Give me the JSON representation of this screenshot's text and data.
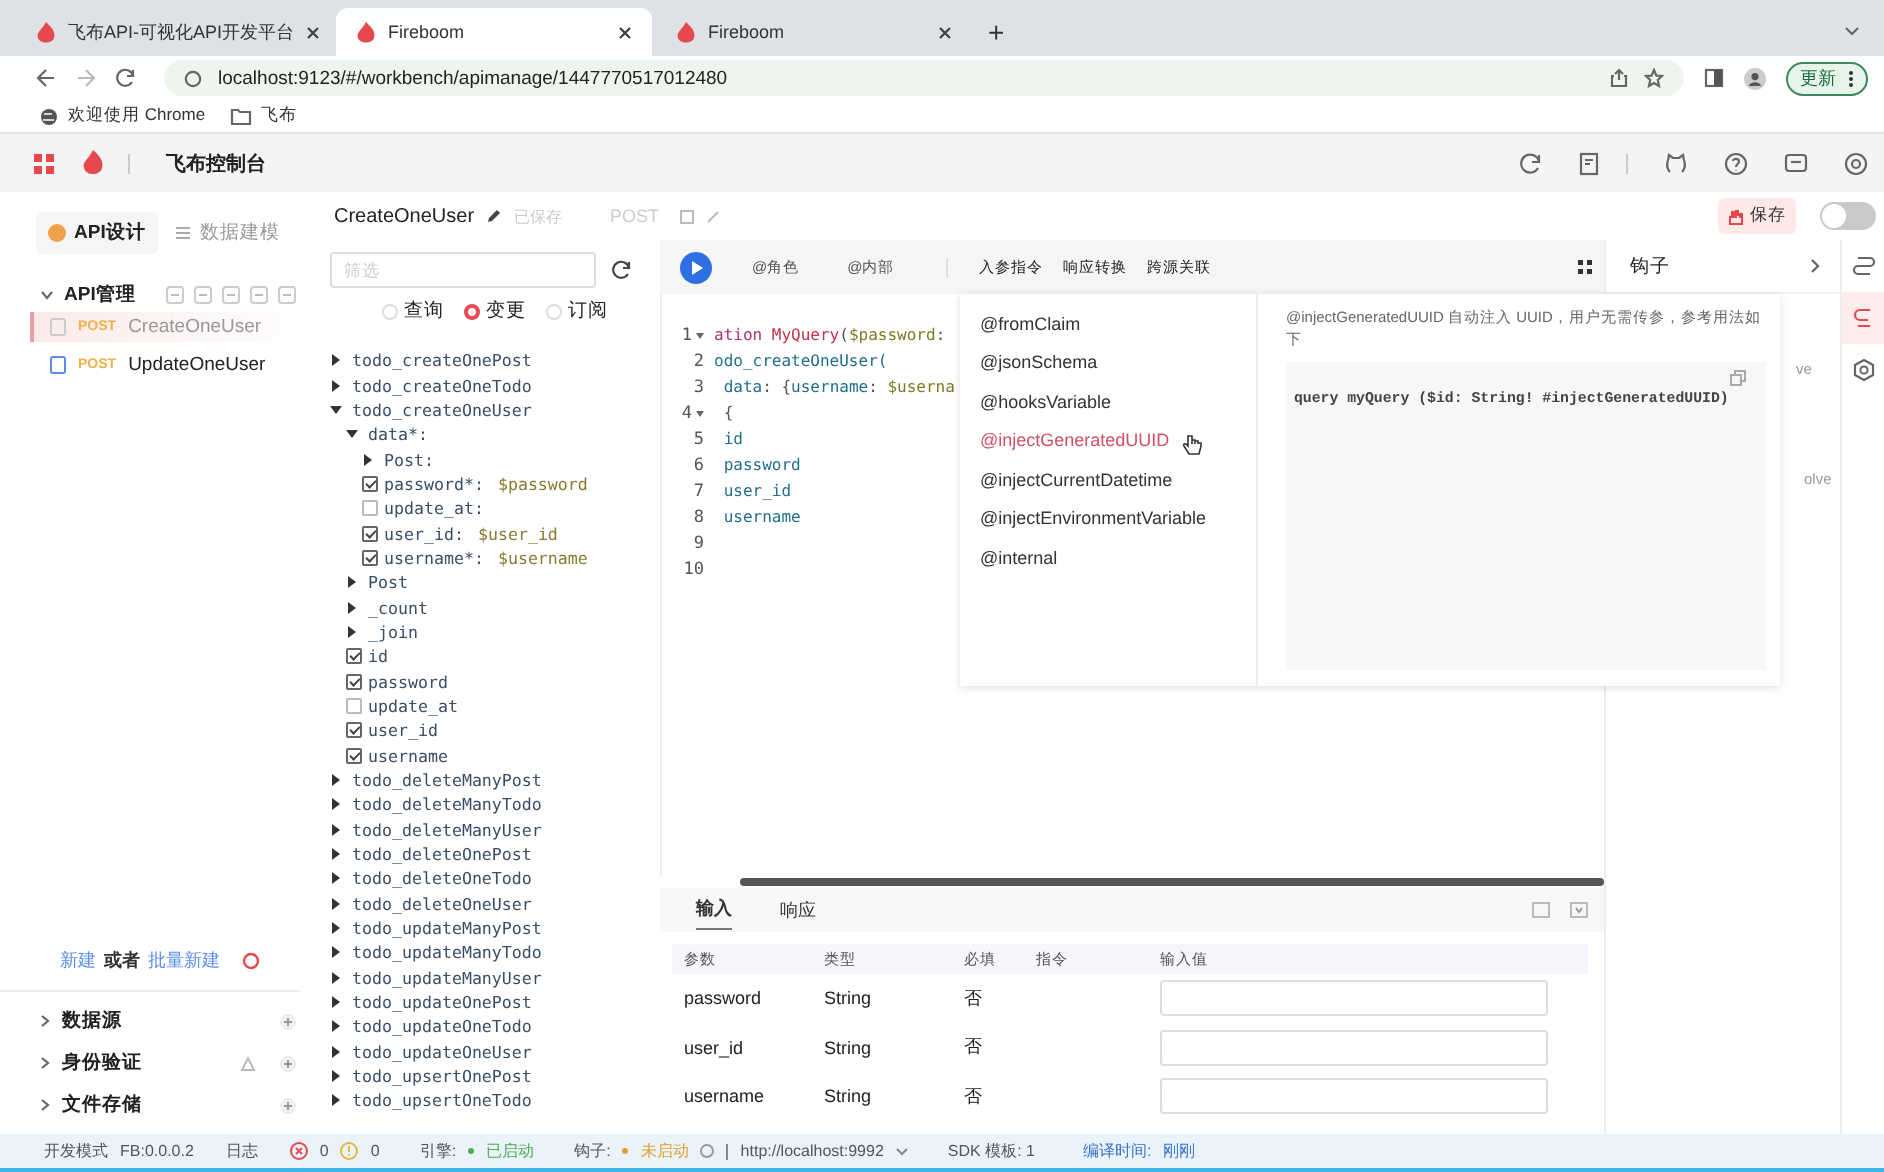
{
  "browser": {
    "tabs": [
      {
        "title": "飞布API-可视化API开发平台",
        "selected": false
      },
      {
        "title": "Fireboom",
        "selected": true
      },
      {
        "title": "Fireboom",
        "selected": false
      }
    ],
    "new_tab": "+",
    "url": "localhost:9123/#/workbench/apimanage/1447770517012480",
    "update_button": "更新",
    "bookmarks": [
      "欢迎使用 Chrome",
      "飞布"
    ]
  },
  "app_header": {
    "title": "飞布控制台"
  },
  "sidebar": {
    "tabs": [
      {
        "label": "API设计",
        "selected": true
      },
      {
        "label": "数据建模",
        "selected": false
      }
    ],
    "section_title": "API管理",
    "apis": [
      {
        "method": "POST",
        "name": "CreateOneUser",
        "selected": true
      },
      {
        "method": "POST",
        "name": "UpdateOneUser",
        "selected": false
      }
    ],
    "create_link": "新建",
    "or_text": "或者",
    "batch_link": "批量新建",
    "sections": [
      "数据源",
      "身份验证",
      "文件存储"
    ]
  },
  "operation": {
    "name": "CreateOneUser",
    "save_status": "已保存",
    "method": "POST",
    "save_button": "保存",
    "toggle_on": false
  },
  "explorer": {
    "filter_placeholder": "筛选",
    "types": [
      {
        "label": "查询",
        "selected": false
      },
      {
        "label": "变更",
        "selected": true
      },
      {
        "label": "订阅",
        "selected": false
      }
    ],
    "tree": [
      {
        "kind": "branch",
        "label": "todo_createOnePost",
        "expanded": false
      },
      {
        "kind": "branch",
        "label": "todo_createOneTodo",
        "expanded": false
      },
      {
        "kind": "branch",
        "label": "todo_createOneUser",
        "expanded": true,
        "children": [
          {
            "kind": "branch",
            "label": "data*:",
            "expanded": true,
            "children": [
              {
                "kind": "branch",
                "label": "Post:",
                "expanded": false
              },
              {
                "kind": "field",
                "label": "password*:",
                "value": "$password",
                "checked": true
              },
              {
                "kind": "field",
                "label": "update_at:",
                "checked": false
              },
              {
                "kind": "field",
                "label": "user_id:",
                "value": "$user_id",
                "checked": true
              },
              {
                "kind": "field",
                "label": "username*:",
                "value": "$username",
                "checked": true
              }
            ]
          },
          {
            "kind": "branch",
            "label": "Post",
            "expanded": false
          },
          {
            "kind": "branch",
            "label": "_count",
            "expanded": false
          },
          {
            "kind": "branch",
            "label": "_join",
            "expanded": false
          },
          {
            "kind": "field",
            "label": "id",
            "checked": true
          },
          {
            "kind": "field",
            "label": "password",
            "checked": true
          },
          {
            "kind": "field",
            "label": "update_at",
            "checked": false
          },
          {
            "kind": "field",
            "label": "user_id",
            "checked": true
          },
          {
            "kind": "field",
            "label": "username",
            "checked": true
          }
        ]
      },
      {
        "kind": "branch",
        "label": "todo_deleteManyPost",
        "expanded": false
      },
      {
        "kind": "branch",
        "label": "todo_deleteManyTodo",
        "expanded": false
      },
      {
        "kind": "branch",
        "label": "todo_deleteManyUser",
        "expanded": false
      },
      {
        "kind": "branch",
        "label": "todo_deleteOnePost",
        "expanded": false
      },
      {
        "kind": "branch",
        "label": "todo_deleteOneTodo",
        "expanded": false
      },
      {
        "kind": "branch",
        "label": "todo_deleteOneUser",
        "expanded": false
      },
      {
        "kind": "branch",
        "label": "todo_updateManyPost",
        "expanded": false
      },
      {
        "kind": "branch",
        "label": "todo_updateManyTodo",
        "expanded": false
      },
      {
        "kind": "branch",
        "label": "todo_updateManyUser",
        "expanded": false
      },
      {
        "kind": "branch",
        "label": "todo_updateOnePost",
        "expanded": false
      },
      {
        "kind": "branch",
        "label": "todo_updateOneTodo",
        "expanded": false
      },
      {
        "kind": "branch",
        "label": "todo_updateOneUser",
        "expanded": false
      },
      {
        "kind": "branch",
        "label": "todo_upsertOnePost",
        "expanded": false
      },
      {
        "kind": "branch",
        "label": "todo_upsertOneTodo",
        "expanded": false
      }
    ]
  },
  "editor": {
    "toolbar": [
      "@角色",
      "@内部"
    ],
    "directive_tabs": [
      "入参指令",
      "响应转换",
      "跨源关联"
    ],
    "lines": [
      {
        "num": "1",
        "fold": true,
        "parts": [
          {
            "text": "ation ",
            "kind": "keyword"
          },
          {
            "text": "MyQuery",
            "kind": "name"
          },
          {
            "text": "(",
            "kind": "plain"
          },
          {
            "text": "$password",
            "kind": "variable"
          },
          {
            "text": ":",
            "kind": "plain"
          }
        ]
      },
      {
        "num": "2",
        "fold": false,
        "parts": [
          {
            "text": "odo_createOneUser(",
            "kind": "field"
          }
        ]
      },
      {
        "num": "3",
        "fold": false,
        "parts": [
          {
            "text": " data",
            "kind": "field"
          },
          {
            "text": ": {",
            "kind": "plain"
          },
          {
            "text": "username",
            "kind": "field"
          },
          {
            "text": ": ",
            "kind": "plain"
          },
          {
            "text": "$userna",
            "kind": "variable"
          }
        ]
      },
      {
        "num": "4",
        "fold": true,
        "parts": [
          {
            "text": " {",
            "kind": "plain"
          }
        ]
      },
      {
        "num": "5",
        "fold": false,
        "parts": [
          {
            "text": " id",
            "kind": "field"
          }
        ]
      },
      {
        "num": "6",
        "fold": false,
        "parts": [
          {
            "text": " password",
            "kind": "field"
          }
        ]
      },
      {
        "num": "7",
        "fold": false,
        "parts": [
          {
            "text": " user_id",
            "kind": "field"
          }
        ]
      },
      {
        "num": "8",
        "fold": false,
        "parts": [
          {
            "text": " username",
            "kind": "field"
          }
        ]
      },
      {
        "num": "9",
        "fold": false
      },
      {
        "num": "10",
        "fold": false
      }
    ],
    "directives": [
      {
        "label": "@fromClaim",
        "selected": false
      },
      {
        "label": "@jsonSchema",
        "selected": false
      },
      {
        "label": "@hooksVariable",
        "selected": false
      },
      {
        "label": "@injectGeneratedUUID",
        "selected": true
      },
      {
        "label": "@injectCurrentDatetime",
        "selected": false
      },
      {
        "label": "@injectEnvironmentVariable",
        "selected": false
      },
      {
        "label": "@internal",
        "selected": false
      }
    ],
    "description": "@injectGeneratedUUID 自动注入 UUID，用户无需传参，参考用法如下",
    "example": "query myQuery ($id: String! #injectGeneratedUUID)"
  },
  "hooks": {
    "title": "钩子",
    "items": [
      "ve",
      "olve"
    ]
  },
  "rail": [
    {
      "selected": false
    },
    {
      "selected": true
    },
    {
      "selected": false
    }
  ],
  "params": {
    "tabs": [
      {
        "label": "输入",
        "selected": true
      },
      {
        "label": "响应",
        "selected": false
      }
    ],
    "columns": [
      "参数",
      "类型",
      "必填",
      "指令",
      "输入值"
    ],
    "rows": [
      {
        "name": "password",
        "type": "String",
        "required": "否"
      },
      {
        "name": "user_id",
        "type": "String",
        "required": "否"
      },
      {
        "name": "username",
        "type": "String",
        "required": "否"
      }
    ]
  },
  "status_bar": {
    "mode": "开发模式",
    "version": "FB:0.0.0.2",
    "log": "日志",
    "errors": "0",
    "warnings": "0",
    "engine": {
      "label": "引擎:",
      "status": "已启动",
      "running": true
    },
    "hooks": {
      "label": "钩子:",
      "status": "未启动",
      "running": false
    },
    "url": "http://localhost:9992",
    "sdk": "SDK 模板: 1",
    "compile_label": "编译时间:",
    "compile_time": "刚刚"
  }
}
